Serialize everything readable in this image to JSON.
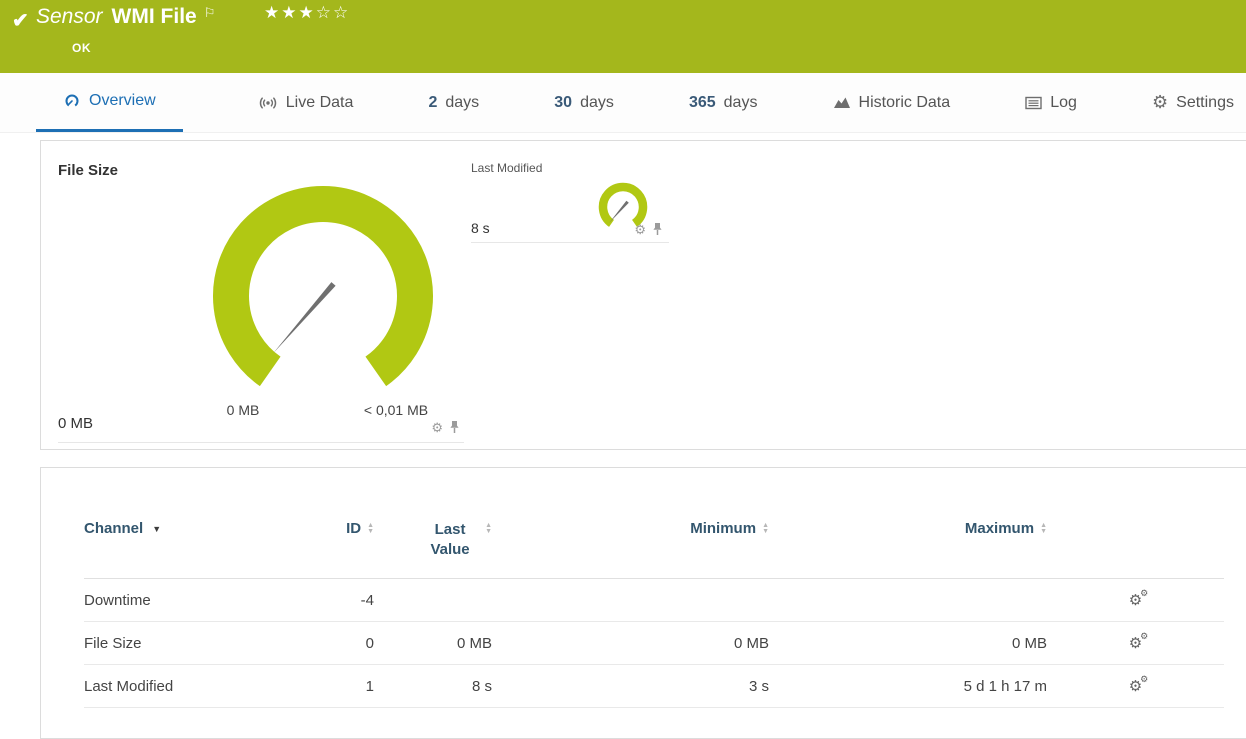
{
  "icons": {
    "check": "✔",
    "flag": "⚐",
    "gear": "⚙",
    "sort_up": "▲",
    "sort_down": "▼",
    "caret": "▼"
  },
  "header": {
    "kind_label": "Sensor",
    "name": "WMI File",
    "stars_filled": "★★★",
    "stars_empty": "☆☆",
    "status": "OK",
    "accent_color": "#a4b71c"
  },
  "tabs": {
    "overview": "Overview",
    "live_data": "Live Data",
    "d2_num": "2",
    "d2_label": "days",
    "d30_num": "30",
    "d30_label": "days",
    "d365_num": "365",
    "d365_label": "days",
    "historic": "Historic Data",
    "log": "Log",
    "settings": "Settings",
    "active_color": "#1d6fb4"
  },
  "gauges": {
    "gauge_color": "#b1c813",
    "needle_color": "#707070",
    "file_size": {
      "title": "File Size",
      "scale_min": "0 MB",
      "scale_max": "< 0,01 MB",
      "value": "0 MB"
    },
    "last_modified": {
      "title": "Last Modified",
      "value": "8 s"
    }
  },
  "table": {
    "col_channel": "Channel",
    "col_id": "ID",
    "col_last_value": "Last Value",
    "col_minimum": "Minimum",
    "col_maximum": "Maximum",
    "rows": [
      {
        "channel": "Downtime",
        "id": "-4",
        "last_value": "",
        "minimum": "",
        "maximum": ""
      },
      {
        "channel": "File Size",
        "id": "0",
        "last_value": "0 MB",
        "minimum": "0 MB",
        "maximum": "0 MB"
      },
      {
        "channel": "Last Modified",
        "id": "1",
        "last_value": "8 s",
        "minimum": "3 s",
        "maximum": "5 d 1 h 17 m"
      }
    ]
  }
}
